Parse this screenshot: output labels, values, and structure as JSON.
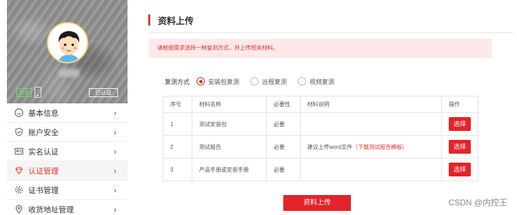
{
  "profile": {
    "real_name_badge": "实名",
    "verified_label": "已认证"
  },
  "sidebar": {
    "items": [
      {
        "label": "基本信息",
        "icon": "smile-icon"
      },
      {
        "label": "账户安全",
        "icon": "shield-icon"
      },
      {
        "label": "实名认证",
        "icon": "id-card-icon"
      },
      {
        "label": "认证管理",
        "icon": "diamond-icon",
        "active": true
      },
      {
        "label": "证书管理",
        "icon": "gear-icon"
      },
      {
        "label": "收货地址管理",
        "icon": "location-icon"
      }
    ]
  },
  "main": {
    "title": "资料上传",
    "notice": "请根据需求选择一种复测方式，并上传相关材料。",
    "method": {
      "label": "复测方式",
      "options": [
        {
          "label": "安装包复测",
          "checked": true
        },
        {
          "label": "远程复测",
          "checked": false
        },
        {
          "label": "视频复测",
          "checked": false
        }
      ]
    },
    "table": {
      "headers": [
        "序号",
        "材料名称",
        "必要性",
        "材料说明",
        "操作"
      ],
      "rows": [
        {
          "no": "1",
          "name": "测试安装包",
          "required": "必要",
          "desc": "",
          "desc_link": "",
          "action": "选择"
        },
        {
          "no": "2",
          "name": "测试报告",
          "required": "必要",
          "desc": "建议上传word文件",
          "desc_link": "（下载测试报告模板）",
          "action": "选择"
        },
        {
          "no": "3",
          "name": "产品手册或安装手册",
          "required": "必要",
          "desc": "",
          "desc_link": "",
          "action": "选择"
        }
      ]
    },
    "upload_button": "资料上传"
  },
  "watermark": "CSDN @内控王",
  "colors": {
    "accent": "#e4322a",
    "notice_bg": "#fde9ea"
  }
}
